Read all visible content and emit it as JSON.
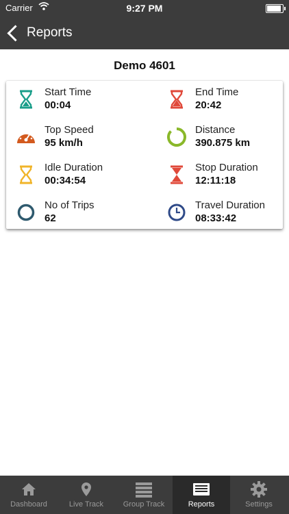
{
  "status_bar": {
    "carrier": "Carrier",
    "time": "9:27 PM",
    "battery_level": 0.9
  },
  "nav": {
    "back_label": "Reports"
  },
  "vehicle": {
    "name": "Demo 4601"
  },
  "stats": {
    "start_time": {
      "label": "Start Time",
      "value": "00:04",
      "icon": "hourglass-icon",
      "color": "#1a9e8a"
    },
    "end_time": {
      "label": "End Time",
      "value": "20:42",
      "icon": "hourglass-icon",
      "color": "#e0493a"
    },
    "top_speed": {
      "label": "Top Speed",
      "value": "95 km/h",
      "icon": "speedometer-icon",
      "color": "#d35a1e"
    },
    "distance": {
      "label": "Distance",
      "value": "390.875 km",
      "icon": "ring-icon",
      "color": "#8ab82a"
    },
    "idle_duration": {
      "label": "Idle Duration",
      "value": "00:34:54",
      "icon": "hourglass-icon",
      "color": "#f0b429"
    },
    "stop_duration": {
      "label": "Stop Duration",
      "value": "12:11:18",
      "icon": "hourglass-icon",
      "color": "#e0493a"
    },
    "no_of_trips": {
      "label": "No of Trips",
      "value": "62",
      "icon": "circle-icon",
      "color": "#2f5a6e"
    },
    "travel_duration": {
      "label": "Travel Duration",
      "value": "08:33:42",
      "icon": "clock-icon",
      "color": "#2f4a88"
    }
  },
  "tabs": [
    {
      "label": "Dashboard",
      "icon": "home-icon",
      "active": false
    },
    {
      "label": "Live Track",
      "icon": "map-pin-icon",
      "active": false
    },
    {
      "label": "Group Track",
      "icon": "list-icon",
      "active": false
    },
    {
      "label": "Reports",
      "icon": "report-icon",
      "active": true
    },
    {
      "label": "Settings",
      "icon": "gear-icon",
      "active": false
    }
  ]
}
